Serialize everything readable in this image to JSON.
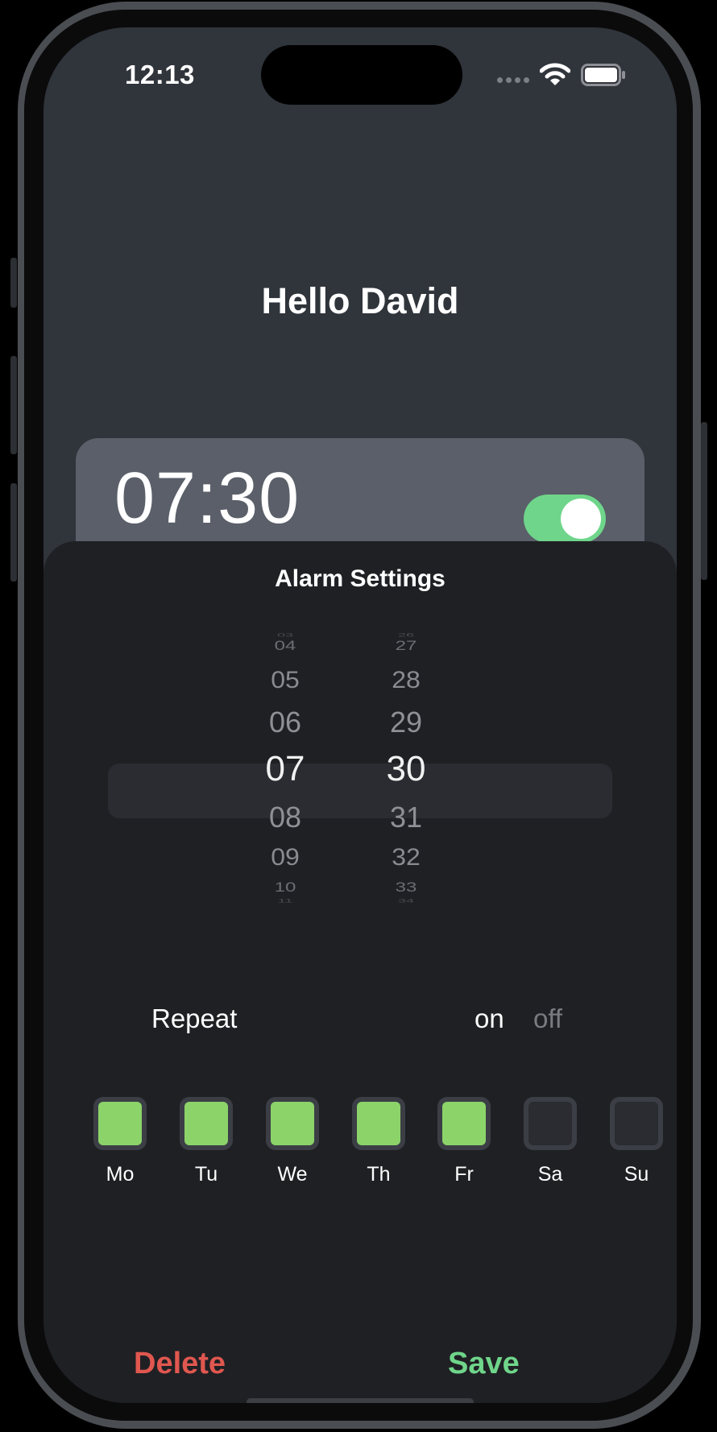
{
  "status_bar": {
    "time": "12:13"
  },
  "greeting": "Hello David",
  "alarm": {
    "time": "07:30",
    "enabled": true
  },
  "sheet": {
    "title": "Alarm Settings",
    "picker": {
      "hours": [
        "03",
        "04",
        "05",
        "06",
        "07",
        "08",
        "09",
        "10",
        "11"
      ],
      "minutes": [
        "26",
        "27",
        "28",
        "29",
        "30",
        "31",
        "32",
        "33",
        "34"
      ],
      "selected_hour": "07",
      "selected_minute": "30"
    },
    "repeat": {
      "label": "Repeat",
      "on_label": "on",
      "off_label": "off",
      "selected": "on"
    },
    "days": [
      {
        "label": "Mo",
        "checked": true
      },
      {
        "label": "Tu",
        "checked": true
      },
      {
        "label": "We",
        "checked": true
      },
      {
        "label": "Th",
        "checked": true
      },
      {
        "label": "Fr",
        "checked": true
      },
      {
        "label": "Sa",
        "checked": false
      },
      {
        "label": "Su",
        "checked": false
      }
    ],
    "delete_label": "Delete",
    "save_label": "Save"
  },
  "colors": {
    "accent_green": "#6fd58a",
    "checkbox_green": "#8cd36a",
    "delete_red": "#e0574f",
    "screen_bg": "#30343b",
    "sheet_bg": "#1f2024",
    "card_bg": "#5a5f69"
  }
}
